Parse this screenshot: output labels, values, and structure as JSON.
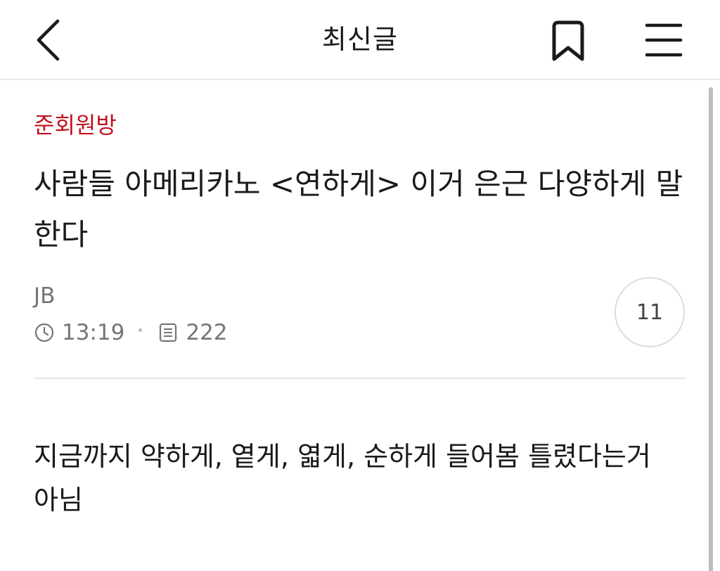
{
  "header": {
    "title": "최신글",
    "back_icon": "chevron-left-icon",
    "bookmark_icon": "bookmark-icon",
    "menu_icon": "hamburger-menu-icon"
  },
  "post": {
    "category": "준회원방",
    "title": "사람들 아메리카노 <연하게> 이거 은근 다양하게 말한다",
    "author": "JB",
    "time": "13:19",
    "views": "222",
    "comment_count": "11",
    "body": "지금까지 약하게, 옅게, 엷게, 순하게 들어봄 틀렸다는거 아님"
  },
  "colors": {
    "category": "#c1121f",
    "text": "#1a1a1a",
    "meta": "#757575",
    "divider": "#e6e6e6"
  }
}
